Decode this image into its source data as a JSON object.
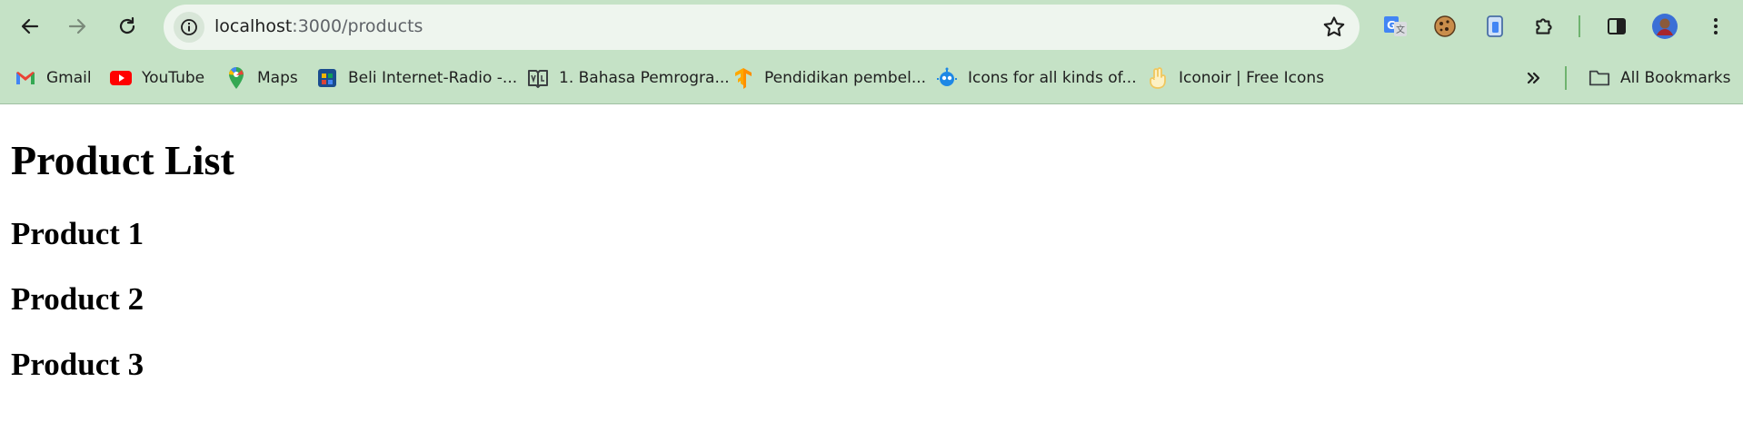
{
  "browser": {
    "url_host": "localhost",
    "url_path": ":3000/products",
    "bookmarks": [
      {
        "label": "Gmail",
        "icon": "gmail-icon"
      },
      {
        "label": "YouTube",
        "icon": "youtube-icon"
      },
      {
        "label": "Maps",
        "icon": "maps-icon"
      },
      {
        "label": "Beli Internet-Radio -...",
        "icon": "radio-app-icon"
      },
      {
        "label": "1. Bahasa Pemrogra...",
        "icon": "book-icon"
      },
      {
        "label": "Pendidikan pembel...",
        "icon": "tensorflow-icon"
      },
      {
        "label": "Icons for all kinds of...",
        "icon": "bot-icon"
      },
      {
        "label": "Iconoir | Free Icons",
        "icon": "hand-icon"
      }
    ],
    "all_bookmarks_label": "All Bookmarks",
    "colors": {
      "frame": "#c5e2c6",
      "omnibox": "#eef5ee",
      "separator": "#6fb36f"
    }
  },
  "page": {
    "title": "Product List",
    "products": [
      "Product 1",
      "Product 2",
      "Product 3"
    ]
  }
}
